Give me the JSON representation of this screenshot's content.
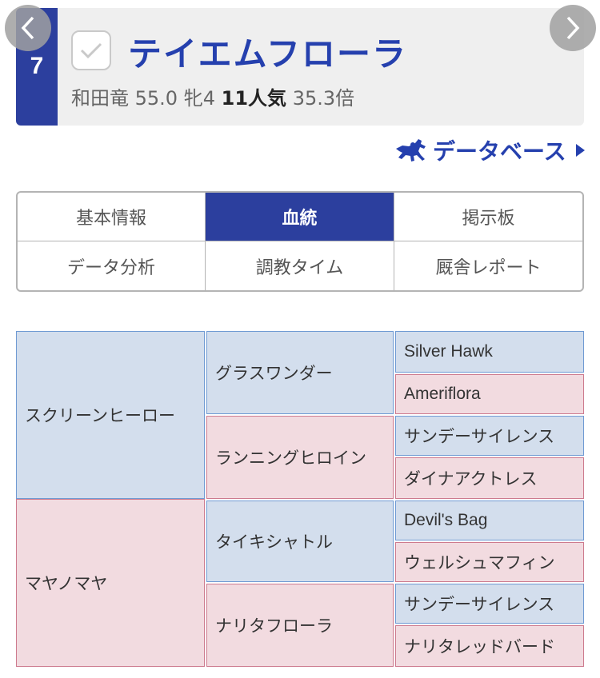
{
  "header": {
    "number": "7",
    "horse_name": "テイエムフローラ",
    "jockey": "和田竜",
    "weight": "55.0",
    "sex_age": "牝4",
    "popularity": "11人気",
    "odds": "35.3倍"
  },
  "database_link": {
    "label": "データベース"
  },
  "tabs": [
    {
      "label": "基本情報",
      "active": false
    },
    {
      "label": "血統",
      "active": true
    },
    {
      "label": "掲示板",
      "active": false
    },
    {
      "label": "データ分析",
      "active": false
    },
    {
      "label": "調教タイム",
      "active": false
    },
    {
      "label": "厩舎レポート",
      "active": false
    }
  ],
  "pedigree": {
    "sire": {
      "name": "スクリーンヒーロー",
      "sire": {
        "name": "グラスワンダー",
        "sire": "Silver Hawk",
        "dam": "Ameriflora"
      },
      "dam": {
        "name": "ランニングヒロイン",
        "sire": "サンデーサイレンス",
        "dam": "ダイナアクトレス"
      }
    },
    "dam": {
      "name": "マヤノマヤ",
      "sire": {
        "name": "タイキシャトル",
        "sire": "Devil's Bag",
        "dam": "ウェルシュマフィン"
      },
      "dam": {
        "name": "ナリタフローラ",
        "sire": "サンデーサイレンス",
        "dam": "ナリタレッドバード"
      }
    }
  },
  "colors": {
    "brand_blue": "#2c3f9e",
    "sire_bg": "#d3deed",
    "dam_bg": "#f2dbe0"
  }
}
